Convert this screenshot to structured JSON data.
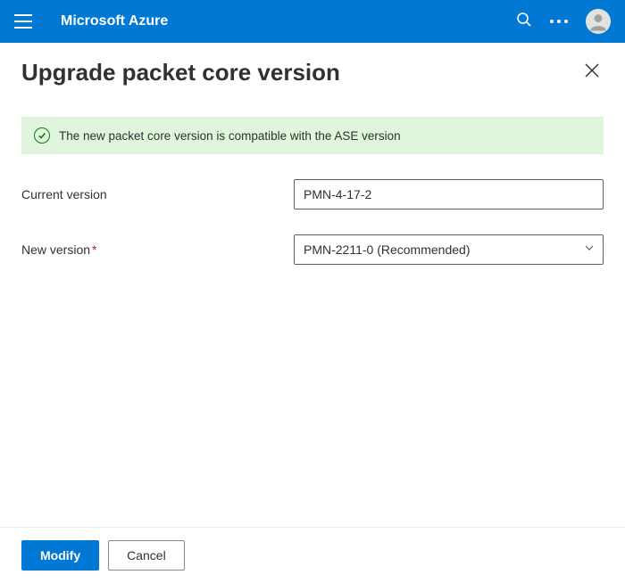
{
  "header": {
    "brand": "Microsoft Azure"
  },
  "panel": {
    "title": "Upgrade packet core version"
  },
  "banner": {
    "message": "The new packet core version is compatible with the ASE version"
  },
  "form": {
    "current_version": {
      "label": "Current version",
      "value": "PMN-4-17-2"
    },
    "new_version": {
      "label": "New version",
      "required_mark": "*",
      "value": "PMN-2211-0 (Recommended)"
    }
  },
  "footer": {
    "primary_label": "Modify",
    "secondary_label": "Cancel"
  }
}
